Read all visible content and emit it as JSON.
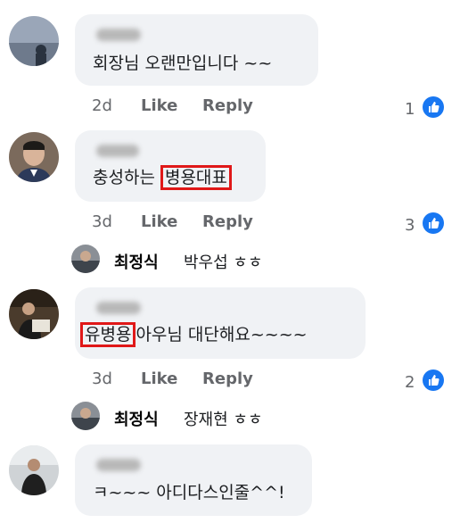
{
  "comments": [
    {
      "text": "회장님 오랜만입니다 ~~",
      "time": "2d",
      "like_label": "Like",
      "reply_label": "Reply",
      "reaction_count": "1"
    },
    {
      "text_highlight": "병용대표",
      "text_before": "충성하는 ",
      "text_after": "",
      "time": "3d",
      "like_label": "Like",
      "reply_label": "Reply",
      "reaction_count": "3",
      "reply_preview": {
        "author": "최정식",
        "text": "박우섭 ㅎㅎ"
      }
    },
    {
      "text_highlight": "유병용",
      "text_before": "",
      "text_after": "아우님 대단해요~~~~",
      "time": "3d",
      "like_label": "Like",
      "reply_label": "Reply",
      "reaction_count": "2",
      "reply_preview": {
        "author": "최정식",
        "text": "장재현 ㅎㅎ"
      }
    },
    {
      "text": "ㅋ~~~ 아디다스인줄^^!"
    }
  ],
  "colors": {
    "bubble": "#f0f2f5",
    "like_blue": "#1877f2",
    "highlight_red": "#e01818",
    "meta_gray": "#65676b"
  }
}
